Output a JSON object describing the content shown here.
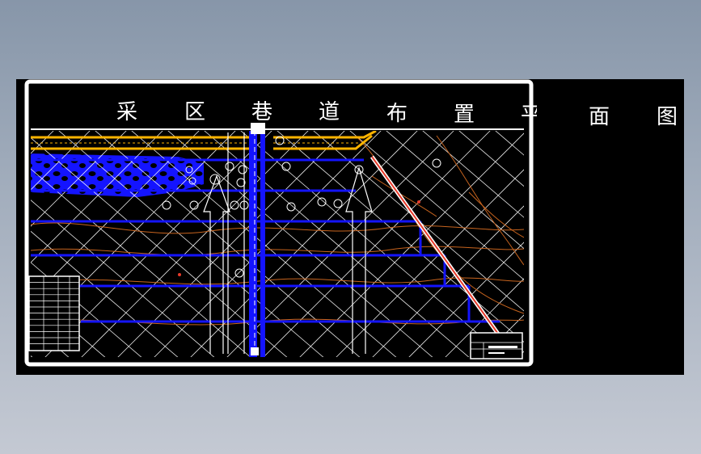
{
  "title": {
    "chars": [
      "采",
      "区",
      "巷",
      "道",
      "布",
      "置",
      "平",
      "面",
      "图"
    ]
  },
  "colors": {
    "background": "#000000",
    "border": "#ffffff",
    "roadway": "#1414ff",
    "coal_pillar": "#ffb400",
    "contour": "#c8641e",
    "fault": "#e83a2a",
    "grid": "#ffffff"
  }
}
